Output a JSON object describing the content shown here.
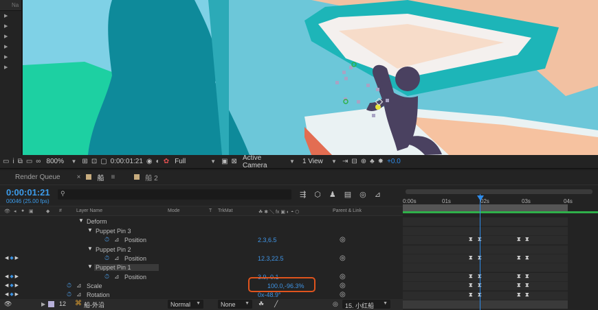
{
  "left_panel": {
    "header": "Na",
    "rows": [
      "▶",
      "▶",
      "▶",
      "▶",
      "▶",
      "▶"
    ]
  },
  "viewer_toolbar": {
    "zoom": "800%",
    "timecode": "0:00:01:21",
    "resolution": "Full",
    "camera": "Active Camera",
    "views": "1 View",
    "exposure": "+0.0"
  },
  "tabs": {
    "render_queue": "Render Queue",
    "comp_active": "船",
    "comp_2": "船 2"
  },
  "timeline": {
    "timecode": "0:00:01:21",
    "frame_info": "00046 (25.00 fps)",
    "search_placeholder": "",
    "columns": {
      "hash": "#",
      "layer_name": "Layer Name",
      "mode": "Mode",
      "t": "T",
      "trkmat": "TrkMat",
      "parent": "Parent & Link"
    },
    "rows": [
      {
        "label": "Deform",
        "value": ""
      },
      {
        "label": "Puppet Pin 3",
        "value": ""
      },
      {
        "label": "Position",
        "value": "2.3,6.5"
      },
      {
        "label": "Puppet Pin 2",
        "value": ""
      },
      {
        "label": "Position",
        "value": "12.3,22.5"
      },
      {
        "label": "Puppet Pin 1",
        "value": ""
      },
      {
        "label": "Position",
        "value": "3.9,-0.1"
      },
      {
        "label": "Scale",
        "value": "100.0,-96.3%"
      },
      {
        "label": "Rotation",
        "value": "0x-48.9°"
      }
    ],
    "layer12": {
      "number": "12",
      "name": "船-外沿",
      "mode": "Normal",
      "trkmat": "None",
      "parent": "15. 小红船"
    }
  },
  "ruler": {
    "ticks": [
      "0:00s",
      "01s",
      "02s",
      "03s",
      "04s"
    ]
  },
  "colors": {
    "accent_blue": "#2d8ceb",
    "highlight_orange": "#e0541d",
    "comp_label": "#c7ac7e"
  }
}
